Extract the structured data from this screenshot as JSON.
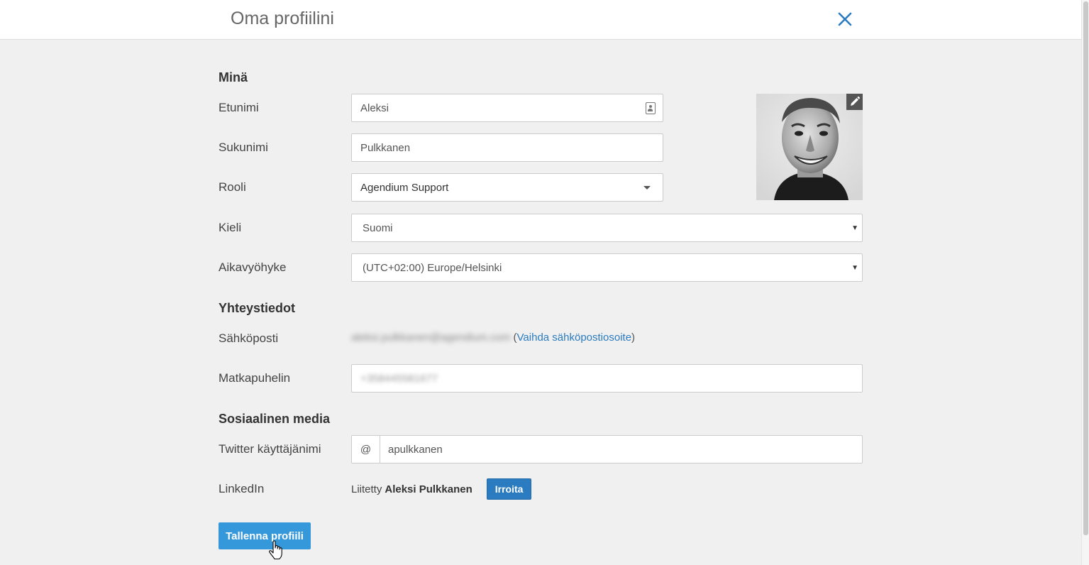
{
  "header": {
    "title": "Oma profiilini",
    "close_icon": "close-icon"
  },
  "colors": {
    "accent": "#2a7bbf",
    "save_button": "#3498db",
    "background": "#f0f0f0"
  },
  "sections": {
    "me": "Minä",
    "contact": "Yhteystiedot",
    "social": "Sosiaalinen media"
  },
  "fields": {
    "first_name": {
      "label": "Etunimi",
      "value": "Aleksi",
      "icon": "contact-card-icon"
    },
    "last_name": {
      "label": "Sukunimi",
      "value": "Pulkkanen"
    },
    "role": {
      "label": "Rooli",
      "value": "Agendium Support"
    },
    "language": {
      "label": "Kieli",
      "value": "Suomi"
    },
    "timezone": {
      "label": "Aikavyöhyke",
      "value": "(UTC+02:00) Europe/Helsinki"
    },
    "email": {
      "label": "Sähköposti",
      "value": "aleksi.pulkkanen@agendium.com",
      "change_link": "Vaihda sähköpostiosoite"
    },
    "mobile": {
      "label": "Matkapuhelin",
      "value": "+358445581677"
    },
    "twitter": {
      "label": "Twitter käyttäjänimi",
      "prefix": "@",
      "value": "apulkkanen"
    },
    "linkedin": {
      "label": "LinkedIn",
      "status": "Liitetty",
      "name": "Aleksi Pulkkanen",
      "disconnect": "Irroita"
    }
  },
  "photo": {
    "edit_icon": "pencil-icon"
  },
  "actions": {
    "save": "Tallenna profiili"
  }
}
